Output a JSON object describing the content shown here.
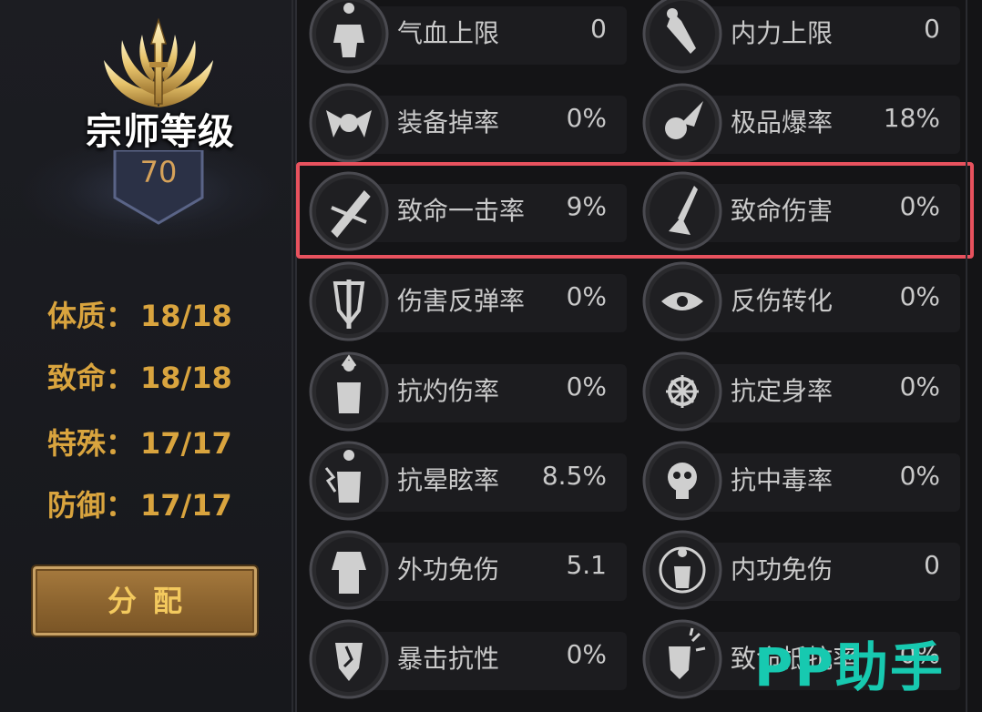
{
  "rank": {
    "title": "宗师等级",
    "level": "70"
  },
  "attributes": [
    {
      "label": "体质：",
      "value": "18/18"
    },
    {
      "label": "致命：",
      "value": "18/18"
    },
    {
      "label": "特殊：",
      "value": "17/17"
    },
    {
      "label": "防御：",
      "value": "17/17"
    }
  ],
  "assign_button": "分配",
  "stats": [
    {
      "name": "气血上限",
      "value": "0",
      "icon": "muscle-body-icon"
    },
    {
      "name": "内力上限",
      "value": "0",
      "icon": "potion-vial-icon"
    },
    {
      "name": "装备掉率",
      "value": "0%",
      "icon": "winged-orb-icon"
    },
    {
      "name": "极品爆率",
      "value": "18%",
      "icon": "comet-icon"
    },
    {
      "name": "致命一击率",
      "value": "9%",
      "icon": "crossed-blades-icon"
    },
    {
      "name": "致命伤害",
      "value": "0%",
      "icon": "piercing-sword-icon"
    },
    {
      "name": "伤害反弹率",
      "value": "0%",
      "icon": "shield-sword-icon"
    },
    {
      "name": "反伤转化",
      "value": "0%",
      "icon": "eye-star-icon"
    },
    {
      "name": "抗灼伤率",
      "value": "0%",
      "icon": "flaming-figure-icon"
    },
    {
      "name": "抗定身率",
      "value": "0%",
      "icon": "frost-ring-icon"
    },
    {
      "name": "抗晕眩率",
      "value": "8.5%",
      "icon": "lightning-figure-icon"
    },
    {
      "name": "抗中毒率",
      "value": "0%",
      "icon": "poison-skull-icon"
    },
    {
      "name": "外功免伤",
      "value": "5.1",
      "icon": "armored-body-icon"
    },
    {
      "name": "内功免伤",
      "value": "0",
      "icon": "aura-figure-icon"
    },
    {
      "name": "暴击抗性",
      "value": "0%",
      "icon": "cracked-shield-icon"
    },
    {
      "name": "致命抵抗率",
      "value": "0%",
      "icon": "burst-shield-icon"
    }
  ],
  "highlighted_row": "致命一击率 / 致命伤害",
  "watermark": "PP助手",
  "colors": {
    "gold": "#d9a43e",
    "highlight": "#e8525e",
    "watermark": "#17c9b0"
  }
}
